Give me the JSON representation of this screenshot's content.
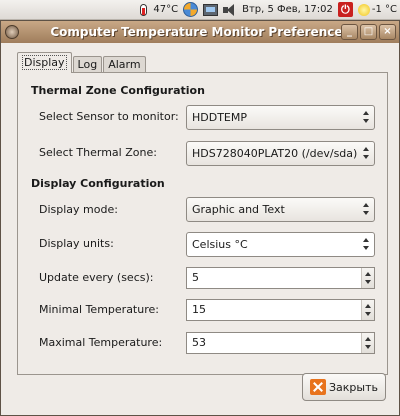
{
  "panel": {
    "cpu_temp": "47°C",
    "clock": "Втр,  5 Фев, 17:02",
    "weather_temp": "-1 °C"
  },
  "window": {
    "title": "Computer Temperature Monitor Preferences",
    "minimize": "_",
    "maximize": "□",
    "close": "×"
  },
  "tabs": [
    "Display",
    "Log",
    "Alarm"
  ],
  "thermal": {
    "section_title": "Thermal Zone Configuration",
    "sensor_label": "Select Sensor to monitor:",
    "sensor_value": "HDDTEMP",
    "zone_label": "Select Thermal Zone:",
    "zone_value": "HDS728040PLAT20 (/dev/sda)"
  },
  "display": {
    "section_title": "Display Configuration",
    "mode_label": "Display mode:",
    "mode_value": "Graphic and Text",
    "units_label": "Display units:",
    "units_value": "Celsius °C",
    "update_label": "Update every (secs):",
    "update_value": "5",
    "min_label": "Minimal Temperature:",
    "min_value": "15",
    "max_label": "Maximal Temperature:",
    "max_value": "53"
  },
  "buttons": {
    "close_label": "Закрыть"
  }
}
